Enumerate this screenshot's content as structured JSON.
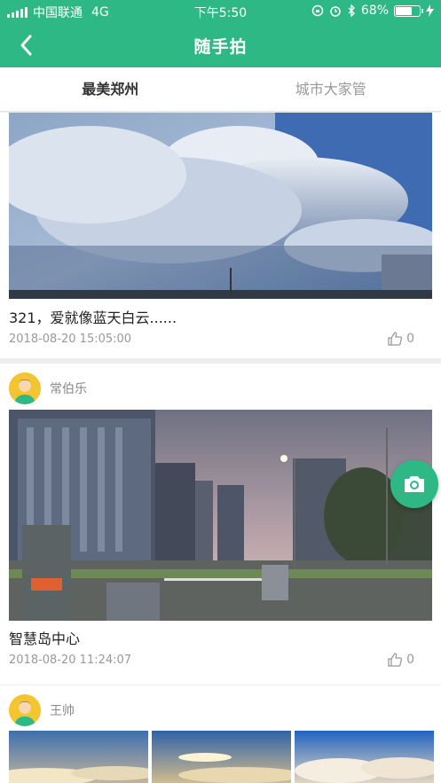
{
  "status_bar": {
    "carrier": "中国联通",
    "network": "4G",
    "time": "下午5:50",
    "battery": "68%",
    "battery_level": 0.68
  },
  "navbar": {
    "title": "随手拍",
    "back_icon": "chevron-left-icon"
  },
  "tabs": [
    {
      "label": "最美郑州",
      "active": true
    },
    {
      "label": "城市大家管",
      "active": false
    }
  ],
  "posts": [
    {
      "caption": "321，爱就像蓝天白云......",
      "time": "2018-08-20 15:05:00",
      "likes": "0"
    },
    {
      "user": "常伯乐",
      "caption": "智慧岛中心",
      "time": "2018-08-20 11:24:07",
      "likes": "0"
    },
    {
      "user": "王帅"
    }
  ],
  "colors": {
    "accent": "#2eb886"
  }
}
